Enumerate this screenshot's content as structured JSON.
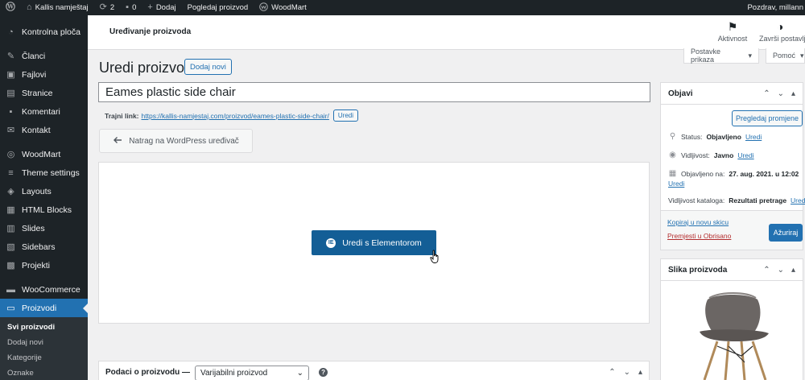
{
  "adminbar": {
    "site_name": "Kallis namještaj",
    "updates_count": "2",
    "comments_count": "0",
    "add_new": "Dodaj",
    "view_product": "Pogledaj proizvod",
    "woodmart": "WoodMart",
    "greeting": "Pozdrav, millann"
  },
  "sidebar": {
    "items": [
      {
        "label": "Kontrolna ploča",
        "icon": "dashboard-icon"
      },
      {
        "label": "Članci",
        "icon": "pin-icon"
      },
      {
        "label": "Fajlovi",
        "icon": "media-icon"
      },
      {
        "label": "Stranice",
        "icon": "page-icon"
      },
      {
        "label": "Komentari",
        "icon": "comment-icon"
      },
      {
        "label": "Kontakt",
        "icon": "mail-icon"
      },
      {
        "label": "WoodMart",
        "icon": "woodmart-icon"
      },
      {
        "label": "Theme settings",
        "icon": "sliders-icon"
      },
      {
        "label": "Layouts",
        "icon": "layers-icon"
      },
      {
        "label": "HTML Blocks",
        "icon": "blocks-icon"
      },
      {
        "label": "Slides",
        "icon": "slides-icon"
      },
      {
        "label": "Sidebars",
        "icon": "sidebar-icon"
      },
      {
        "label": "Projekti",
        "icon": "portfolio-icon"
      },
      {
        "label": "WooCommerce",
        "icon": "woocommerce-icon"
      },
      {
        "label": "Proizvodi",
        "icon": "archive-icon"
      }
    ],
    "submenu": [
      "Svi proizvodi",
      "Dodaj novi",
      "Kategorije",
      "Oznake"
    ]
  },
  "header": {
    "title": "Uređivanje proizvoda",
    "activity": "Aktivnost",
    "finish_setup": "Završi postavlj"
  },
  "screen_options": {
    "display_settings": "Postavke prikaza",
    "help": "Pomoć"
  },
  "page": {
    "title": "Uredi proizvod",
    "add_new": "Dodaj novi",
    "product_title": "Eames plastic side chair",
    "permalink_label": "Trajni link:",
    "permalink_url": "https://kallis-namjestaj.com/proizvod/eames-plastic-side-chair/",
    "permalink_edit": "Uredi",
    "back_button": "Natrag na WordPress uređivač",
    "elementor_button": "Uredi s Elementorom",
    "elementor_badge": "IE"
  },
  "product_data": {
    "label": "Podaci o proizvodu —",
    "type": "Varijabilni proizvod",
    "help": "?"
  },
  "publish": {
    "title": "Objavi",
    "preview": "Pregledaj promjene",
    "status_label": "Status:",
    "status_value": "Objavljeno",
    "status_edit": "Uredi",
    "visibility_label": "Vidljivost:",
    "visibility_value": "Javno",
    "visibility_edit": "Uredi",
    "published_label": "Objavljeno na:",
    "published_value": "27. aug. 2021. u 12:02",
    "published_edit": "Uredi",
    "catalog_label": "Vidljivost kataloga:",
    "catalog_value": "Rezultati pretrage",
    "catalog_edit": "Uredi",
    "copy_draft": "Kopiraj u novu skicu",
    "trash": "Premjesti u Obrisano",
    "update": "Ažuriraj"
  },
  "product_image": {
    "title": "Slika proizvoda"
  },
  "colors": {
    "admin_dark": "#1d2327",
    "accent": "#2271b1",
    "elementor_button": "#135e96",
    "trash": "#b32d2e"
  }
}
